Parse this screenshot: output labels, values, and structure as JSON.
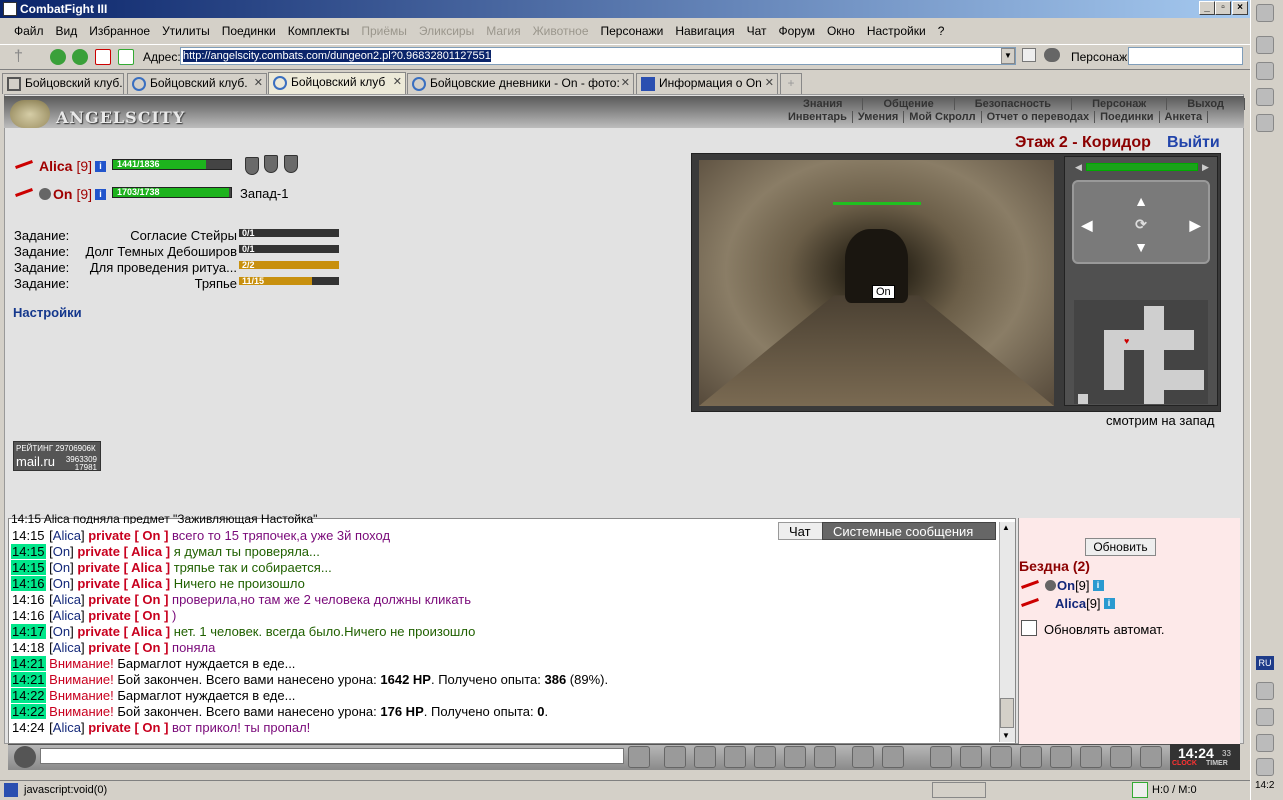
{
  "window": {
    "title": "CombatFight III"
  },
  "menu": [
    "Файл",
    "Вид",
    "Избранное",
    "Утилиты",
    "Поединки",
    "Комплекты",
    "Приёмы",
    "Эликсиры",
    "Магия",
    "Животное",
    "Персонажи",
    "Навигация",
    "Чат",
    "Форум",
    "Окно",
    "Настройки",
    "?"
  ],
  "address": {
    "label": "Адрес:",
    "url": "http://angelscity.combats.com/dungeon2.pl?0.96832801127551",
    "character_label": "Персонаж:"
  },
  "tabs": [
    {
      "label": "Бойцовский клуб."
    },
    {
      "label": "Бойцовский клуб."
    },
    {
      "label": "Бойцовский клуб"
    },
    {
      "label": "Бойцовские дневники - On - фото:"
    },
    {
      "label": "Информация о On"
    }
  ],
  "game": {
    "logo": "ANGELSCITY",
    "nav_top": [
      "Знания",
      "Общение",
      "Безопасность",
      "Персонаж",
      "Выход"
    ],
    "nav_bottom": [
      "Инвентарь",
      "Умения",
      "Мой Скролл",
      "Отчет о переводах",
      "Поединки",
      "Анкета"
    ],
    "players": [
      {
        "name": "Alica",
        "level": "[9]",
        "hp": "1441/1836",
        "hp_frac": 0.785
      },
      {
        "name": "On",
        "level": "[9]",
        "hp": "1703/1738",
        "hp_frac": 0.98,
        "location": "Запад-1"
      }
    ],
    "tasks": [
      {
        "label": "Задание:",
        "name": "Согласие Стейры",
        "progress": "0/1",
        "frac": 0
      },
      {
        "label": "Задание:",
        "name": "Долг Темных Дебоширов",
        "progress": "0/1",
        "frac": 0
      },
      {
        "label": "Задание:",
        "name": "Для проведения ритуа...",
        "progress": "2/2",
        "frac": 1
      },
      {
        "label": "Задание:",
        "name": "Тряпье",
        "progress": "11/15",
        "frac": 0.73
      }
    ],
    "settings_link": "Настройки",
    "rating": {
      "label": "РЕЙТИНГ 29706906К",
      "brand": "mail.ru",
      "n1": "3963309",
      "n2": "17981"
    },
    "location_title": "Этаж 2 - Коридор",
    "exit": "Выйти",
    "object_label": "On",
    "look_direction": "смотрим на запад"
  },
  "chat": {
    "tab_chat": "Чат",
    "tab_system": "Системные сообщения",
    "partial_top": "14:15 Alica подняла предмет \"Заживляющая Настойка\"",
    "lines": [
      {
        "time": "14:15",
        "hl": false,
        "from": "Alica",
        "to": "On",
        "text": "всего то 15 тряпочек,а уже 3й поход",
        "color": "msg"
      },
      {
        "time": "14:15",
        "hl": true,
        "from": "On",
        "to": "Alica",
        "text": "я думал ты проверяла...",
        "color": "msgg"
      },
      {
        "time": "14:15",
        "hl": true,
        "from": "On",
        "to": "Alica",
        "text": "тряпье так и собирается...",
        "color": "msgg"
      },
      {
        "time": "14:16",
        "hl": true,
        "from": "On",
        "to": "Alica",
        "text": "Ничего не произошло",
        "color": "msgg"
      },
      {
        "time": "14:16",
        "hl": false,
        "from": "Alica",
        "to": "On",
        "text": "проверила,но там же 2 человека должны кликать",
        "color": "msg"
      },
      {
        "time": "14:16",
        "hl": false,
        "from": "Alica",
        "to": "On",
        "text": ")",
        "color": "msg"
      },
      {
        "time": "14:17",
        "hl": true,
        "from": "On",
        "to": "Alica",
        "text": "нет. 1 человек. всегда было.Ничего не произошло",
        "color": "msgg"
      },
      {
        "time": "14:18",
        "hl": false,
        "from": "Alica",
        "to": "On",
        "text": "поняла",
        "color": "msg"
      }
    ],
    "system_lines": [
      {
        "time": "14:21",
        "warn": "Внимание!",
        "text": "Бармаглот нуждается в еде..."
      },
      {
        "time": "14:21",
        "warn": "Внимание!",
        "text_a": "Бой закончен. Всего вами нанесено урона:",
        "dmg": "1642 HP",
        "text_b": ". Получено опыта:",
        "exp": "386",
        "text_c": " (89%)."
      },
      {
        "time": "14:22",
        "warn": "Внимание!",
        "text": "Бармаглот нуждается в еде..."
      },
      {
        "time": "14:22",
        "warn": "Внимание!",
        "text_a": "Бой закончен. Всего вами нанесено урона:",
        "dmg": "176 HP",
        "text_b": ". Получено опыта:",
        "exp": "0",
        "text_c": "."
      }
    ],
    "last": {
      "time": "14:24",
      "from": "Alica",
      "to": "On",
      "text": "вот прикол! ты пропал!"
    },
    "private": "private"
  },
  "room": {
    "refresh": "Обновить",
    "title": "Бездна (2)",
    "members": [
      {
        "name": "On",
        "level": "[9]"
      },
      {
        "name": "Alica",
        "level": "[9]"
      }
    ],
    "auto_refresh": "Обновлять автомат."
  },
  "clock": {
    "time": "14:24",
    "seconds": "33",
    "clock_label": "CLOCK",
    "timer_label": "TIMER"
  },
  "status": {
    "text": "javascript:void(0)",
    "right": "H:0 / M:0"
  },
  "tray": {
    "lang": "RU",
    "time": "14:2"
  }
}
